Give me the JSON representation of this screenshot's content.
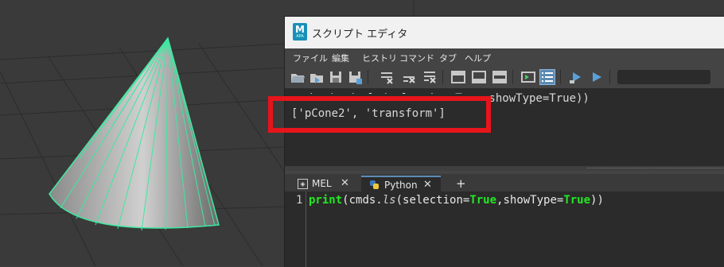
{
  "window": {
    "title": "スクリプト エディタ",
    "app_icon_letter": "M",
    "app_icon_sub": "APA"
  },
  "menu": [
    "ファイル",
    "編集",
    "ヒストリ",
    "コマンド",
    "タブ",
    "ヘルプ"
  ],
  "history": {
    "line1": "print(cmds.ls(selection=True,showType=True))",
    "line2": "['pCone2', 'transform']"
  },
  "tabs": {
    "mel": "MEL",
    "python": "Python",
    "add": "+"
  },
  "editor": {
    "line_number": "1",
    "code": {
      "print": "print",
      "open1": "(cmds.",
      "ls": "ls",
      "arg1": "(selection=",
      "true1": "True",
      "arg2": ",showType=",
      "true2": "True",
      "close": "))"
    }
  },
  "colors": {
    "highlight_box": "#e8141b",
    "wireframe": "#3ee8a0",
    "keyword": "#23e823"
  }
}
